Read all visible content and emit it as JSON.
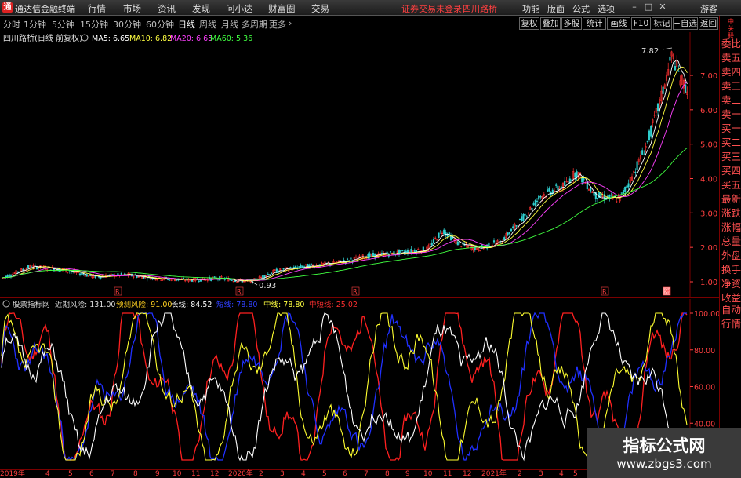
{
  "app": {
    "logo": "通",
    "name": "通达信金融终端"
  },
  "menu": [
    "行情",
    "市场",
    "资讯",
    "发现",
    "问小达",
    "财富圈",
    "交易"
  ],
  "notice": "证券交易未登录",
  "stock_name_top": "四川路桥",
  "right_menu": [
    "功能",
    "版面",
    "公式",
    "选项"
  ],
  "guest": "游客",
  "window_buttons": [
    "–",
    "□",
    "✕"
  ],
  "periods": [
    "分时",
    "1分钟",
    "5分钟",
    "15分钟",
    "30分钟",
    "60分钟",
    "日线",
    "周线",
    "月线",
    "多周期",
    "更多"
  ],
  "active_period": "日线",
  "more_arrow": "›",
  "toolbar_buttons": [
    "复权",
    "叠加",
    "多股",
    "统计",
    "画线",
    "F10",
    "标记",
    "+自选",
    "返回"
  ],
  "price_panel": {
    "title": "四川路桥(日线 前复权)",
    "ma": [
      {
        "label": "MA5: 6.65",
        "color": "#ffffff"
      },
      {
        "label": "MA10: 6.82",
        "color": "#ffff40"
      },
      {
        "label": "MA20: 6.65",
        "color": "#ff40ff"
      },
      {
        "label": "MA60: 5.36",
        "color": "#40ff40"
      }
    ],
    "y_ticks": [
      "7.00",
      "6.00",
      "5.00",
      "4.00",
      "3.00",
      "2.00",
      "1.00"
    ],
    "high_label": "7.82",
    "low_label": "0.93",
    "markers": [
      "R",
      "R",
      "R",
      "R",
      "R"
    ],
    "end_marker": "涨"
  },
  "indicator_panel": {
    "name": "股票指标网",
    "lines": [
      {
        "label": "近期风险: 131.00",
        "color": "#dddddd"
      },
      {
        "label": "预测风险: 91.00",
        "color": "#ffd020"
      },
      {
        "label": "长线: 84.52",
        "color": "#ffffff"
      },
      {
        "label": "短线: 78.80",
        "color": "#3040ff"
      },
      {
        "label": "中线: 78.80",
        "color": "#ffff40"
      },
      {
        "label": "中短线: 25.02",
        "color": "#ff3030"
      }
    ],
    "y_ticks": [
      "100.00",
      "80.00",
      "60.00",
      "40.00"
    ]
  },
  "x_axis": [
    "2019年",
    "4",
    "5",
    "6",
    "7",
    "8",
    "9",
    "10",
    "11",
    "12",
    "2020年",
    "2",
    "3",
    "4",
    "5",
    "6",
    "7",
    "8",
    "9",
    "10",
    "11",
    "12",
    "2021年",
    "2",
    "3",
    "4",
    "5",
    "6"
  ],
  "right_sidebar": {
    "top": "中\n关\n联",
    "items": [
      "委比",
      "卖五",
      "卖四",
      "卖三",
      "卖二",
      "卖一",
      "买一",
      "买二",
      "买三",
      "买四",
      "买五",
      "最新",
      "涨跌",
      "涨幅",
      "总量",
      "外盘",
      "换手",
      "净资",
      "收益",
      "自动",
      "行情"
    ]
  },
  "watermark": {
    "title": "指标公式网",
    "url": "www.zbgs3.com"
  }
}
